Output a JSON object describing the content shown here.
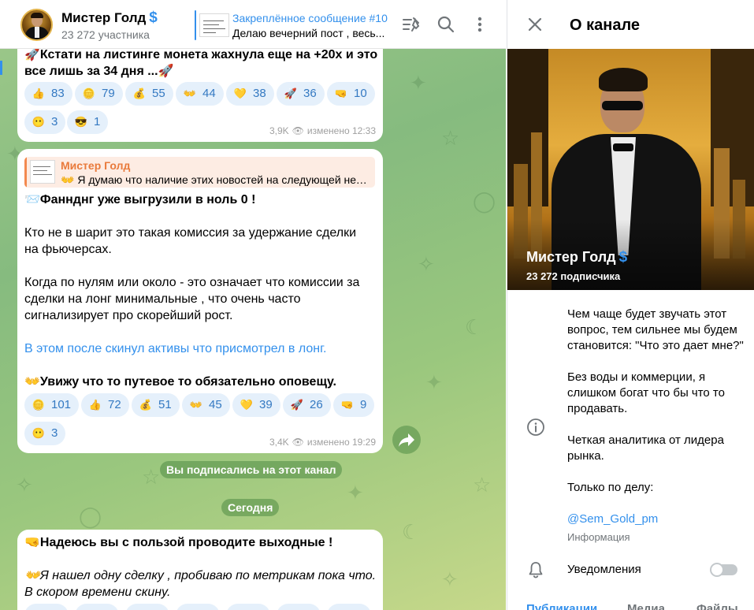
{
  "chat": {
    "title": "Мистер Голд",
    "verified_badge": "$",
    "subtitle": "23 272 участника",
    "pinned": {
      "title": "Закреплённое сообщение #10",
      "text": "Делаю вечерний пост , весь..."
    },
    "header_icons": [
      "pin-list-icon",
      "search-icon",
      "more-vertical-icon"
    ]
  },
  "messages": [
    {
      "lines": [
        "🚀Кстати на листинге монета жахнула еще на +20х  и это",
        "все лишь за 34 дня ...🚀"
      ],
      "reactions": [
        {
          "emoji": "👍",
          "count": "83"
        },
        {
          "emoji": "🪙",
          "count": "79"
        },
        {
          "emoji": "💰",
          "count": "55"
        },
        {
          "emoji": "👐",
          "count": "44"
        },
        {
          "emoji": "💛",
          "count": "38"
        },
        {
          "emoji": "🚀",
          "count": "36"
        },
        {
          "emoji": "🤜",
          "count": "10"
        },
        {
          "emoji": "😶",
          "count": "3"
        },
        {
          "emoji": "😎",
          "count": "1"
        }
      ],
      "views": "3,9K",
      "edited": "изменено 12:33"
    },
    {
      "reply": {
        "author": "Мистер Голд",
        "text": "👐 Я думаю что наличие этих новостей на следующей неде..."
      },
      "p1": "📨Фаннднг уже выгрузили в ноль 0 !",
      "p2a": "Кто не в шарит это такая комиссия за удержание сделки",
      "p2b": "на фьючерсах.",
      "p3a": "Когда по нулям или около - это означает что комиссии за",
      "p3b": "сделки на лонг минимальные , что очень часто",
      "p3c": "сигнализирует про скорейший рост.",
      "link": "В этом после скинул активы что присмотрел в лонг.",
      "p5": "👐Увижу что то путевое то обязательно оповещу.",
      "reactions": [
        {
          "emoji": "🪙",
          "count": "101"
        },
        {
          "emoji": "👍",
          "count": "72"
        },
        {
          "emoji": "💰",
          "count": "51"
        },
        {
          "emoji": "👐",
          "count": "45"
        },
        {
          "emoji": "💛",
          "count": "39"
        },
        {
          "emoji": "🚀",
          "count": "26"
        },
        {
          "emoji": "🤜",
          "count": "9"
        },
        {
          "emoji": "😶",
          "count": "3"
        }
      ],
      "views": "3,4K",
      "edited": "изменено 19:29"
    },
    {
      "p1": "🤜Надеюсь вы с пользой проводите выходные !",
      "p2a": "👐Я нашел одну сделку , пробиваю по метрикам пока что.",
      "p2b": "В скором времени скину."
    }
  ],
  "service": {
    "subscribed": "Вы подписались на этот канал",
    "today": "Сегодня"
  },
  "panel": {
    "title": "О канале",
    "hero_name": "Мистер Голд",
    "hero_badge": "$",
    "hero_subs": "23 272 подписчика",
    "about": [
      "Чем чаще будет звучать этот вопрос, тем сильнее мы будем становится: \"Что это дает мне?\"",
      "Без воды и коммерции, я слишком богат что бы что то продавать.",
      "Четкая аналитика от лидера рынка.",
      "Только по делу:"
    ],
    "handle": "@Sem_Gold_pm",
    "info_label": "Информация",
    "notifications": "Уведомления",
    "tabs": [
      "Публикации",
      "Медиа",
      "Файлы"
    ]
  },
  "colors": {
    "accent": "#3390ec",
    "reaction_bg": "#e5f0fb",
    "reply_author": "#e97a3b",
    "chat_bg": "#8fc282"
  }
}
